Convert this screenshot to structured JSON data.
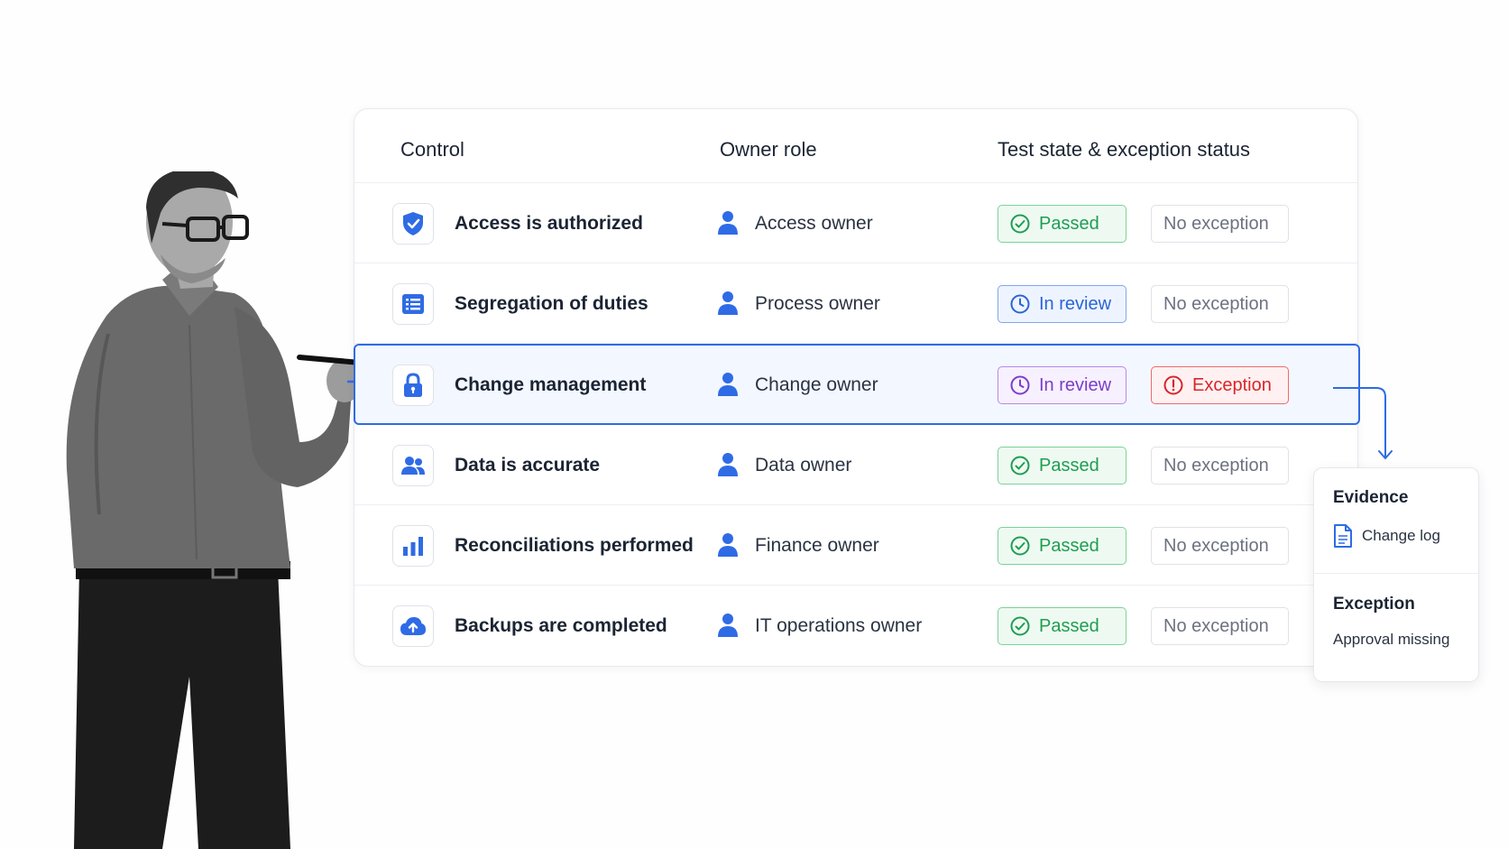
{
  "table": {
    "headers": {
      "control": "Control",
      "owner_role": "Owner role",
      "test_state": "Test state & exception status"
    },
    "rows": [
      {
        "control": "Access is authorized",
        "icon": "shield-check-icon",
        "owner": "Access owner",
        "test": "Passed",
        "test_kind": "passed",
        "exception": "No exception",
        "exception_kind": "none"
      },
      {
        "control": "Segregation of duties",
        "icon": "list-icon",
        "owner": "Process owner",
        "test": "In review",
        "test_kind": "review",
        "exception": "No exception",
        "exception_kind": "none"
      },
      {
        "control": "Change management",
        "icon": "lock-icon",
        "owner": "Change owner",
        "test": "In review",
        "test_kind": "review",
        "exception": "Exception",
        "exception_kind": "exception",
        "selected": true
      },
      {
        "control": "Data is accurate",
        "icon": "users-icon",
        "owner": "Data owner",
        "test": "Passed",
        "test_kind": "passed",
        "exception": "No exception",
        "exception_kind": "none"
      },
      {
        "control": "Reconciliations performed",
        "icon": "bar-chart-icon",
        "owner": "Finance owner",
        "test": "Passed",
        "test_kind": "passed",
        "exception": "No exception",
        "exception_kind": "none"
      },
      {
        "control": "Backups are completed",
        "icon": "cloud-upload-icon",
        "owner": "IT operations owner",
        "test": "Passed",
        "test_kind": "passed",
        "exception": "No exception",
        "exception_kind": "none"
      }
    ]
  },
  "panel": {
    "evidence_title": "Evidence",
    "evidence_item": "Change log",
    "exception_title": "Exception",
    "exception_text": "Approval missing"
  },
  "colors": {
    "accent": "#2f6be5",
    "passed": "#1f9d52",
    "review": "#2a64d8",
    "review_selected": "#7b3ec9",
    "exception": "#d8262a",
    "muted": "#6b7280"
  }
}
